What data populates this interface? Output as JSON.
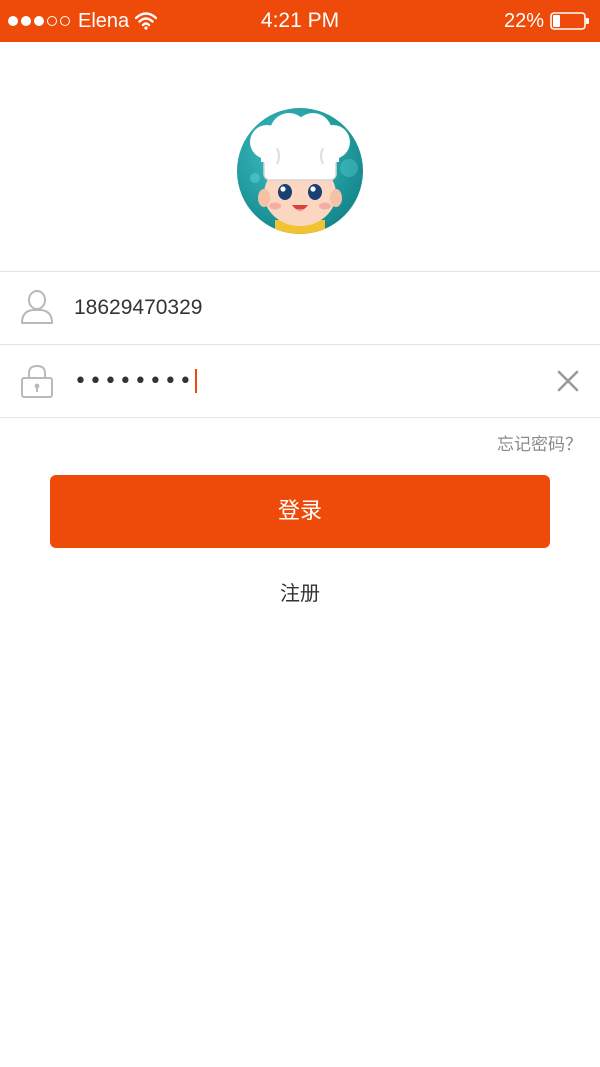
{
  "status_bar": {
    "carrier": "Elena",
    "time": "4:21 PM",
    "battery": "22%",
    "signal_bars_filled": 3,
    "signal_bars_total": 5,
    "battery_level": 0.22,
    "background_color": "#ee4a0a"
  },
  "login_form": {
    "username_value": "18629470329",
    "password_value": "••••••••",
    "forgot_password_label": "忘记密码？",
    "login_label": "登录",
    "register_label": "注册"
  },
  "icons": {
    "user": "user-icon",
    "lock": "lock-icon",
    "clear": "close-icon",
    "avatar": "chef-avatar-icon"
  },
  "colors": {
    "accent": "#ee4a0a",
    "divider": "#e4e4e4",
    "muted_text": "#8a8a8a"
  }
}
